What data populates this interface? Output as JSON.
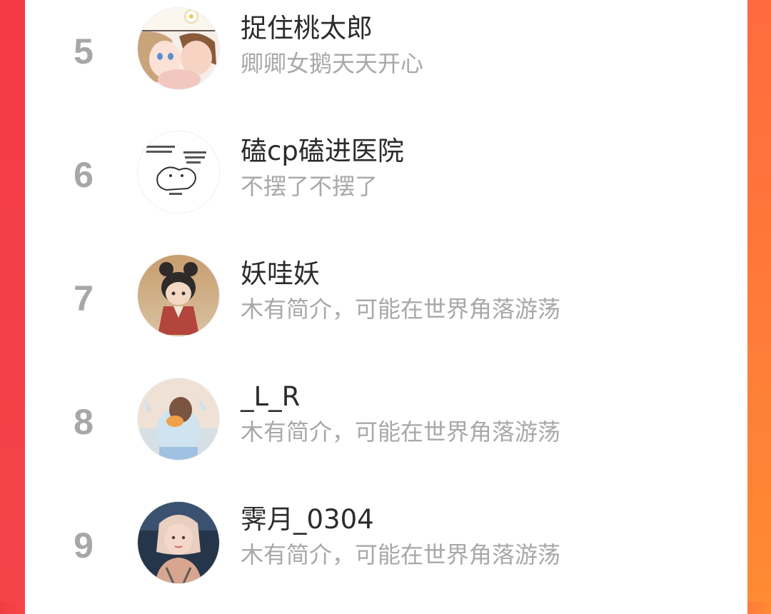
{
  "ranking": {
    "items": [
      {
        "rank": "5",
        "name": "捉住桃太郎",
        "bio": "卿卿女鹅天天开心",
        "avatar_icon": "anime-couple-avatar-icon"
      },
      {
        "rank": "6",
        "name": "磕cp磕进医院",
        "bio": "不摆了不摆了",
        "avatar_icon": "meme-bear-avatar-icon"
      },
      {
        "rank": "7",
        "name": "妖哇妖",
        "bio": "木有简介，可能在世界角落游荡",
        "avatar_icon": "cartoon-girl-avatar-icon"
      },
      {
        "rank": "8",
        "name": "_L_R",
        "bio": "木有简介，可能在世界角落游荡",
        "avatar_icon": "duck-plush-avatar-icon"
      },
      {
        "rank": "9",
        "name": "霁月_0304",
        "bio": "木有简介，可能在世界角落游荡",
        "avatar_icon": "portrait-photo-avatar-icon"
      }
    ]
  },
  "colors": {
    "left_border": "#f43a45",
    "right_border": "#ff8b33",
    "rank_text": "#a7a7a7",
    "name_text": "#2b2b2b",
    "bio_text": "#a8a8a8"
  }
}
